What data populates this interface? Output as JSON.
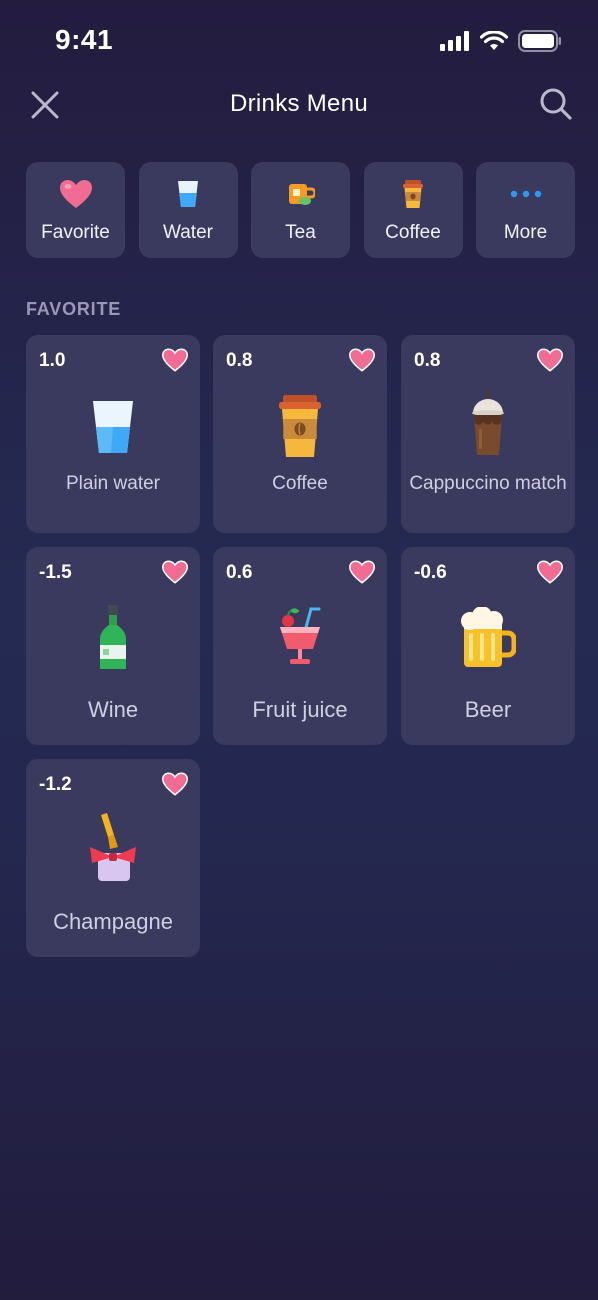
{
  "status": {
    "time": "9:41"
  },
  "nav": {
    "title": "Drinks Menu"
  },
  "categories": [
    {
      "label": "Favorite",
      "icon": "heart-icon"
    },
    {
      "label": "Water",
      "icon": "water-glass-icon"
    },
    {
      "label": "Tea",
      "icon": "tea-cup-icon"
    },
    {
      "label": "Coffee",
      "icon": "coffee-cup-icon"
    },
    {
      "label": "More",
      "icon": "more-dots-icon"
    }
  ],
  "section": {
    "title": "FAVORITE"
  },
  "drinks": [
    {
      "score": "1.0",
      "name": "Plain water",
      "icon": "water-glass-icon"
    },
    {
      "score": "0.8",
      "name": "Coffee",
      "icon": "coffee-cup-icon"
    },
    {
      "score": "0.8",
      "name": "Cappuccino match",
      "icon": "iced-coffee-icon"
    },
    {
      "score": "-1.5",
      "name": "Wine",
      "icon": "wine-bottle-icon"
    },
    {
      "score": "0.6",
      "name": "Fruit juice",
      "icon": "fruit-juice-icon"
    },
    {
      "score": "-0.6",
      "name": "Beer",
      "icon": "beer-mug-icon"
    },
    {
      "score": "-1.2",
      "name": "Champagne",
      "icon": "champagne-bottle-icon"
    }
  ],
  "colors": {
    "background": "#252a52",
    "card": "#3a3a5e",
    "heart": "#f06c92",
    "section_title": "#9a99b5"
  }
}
